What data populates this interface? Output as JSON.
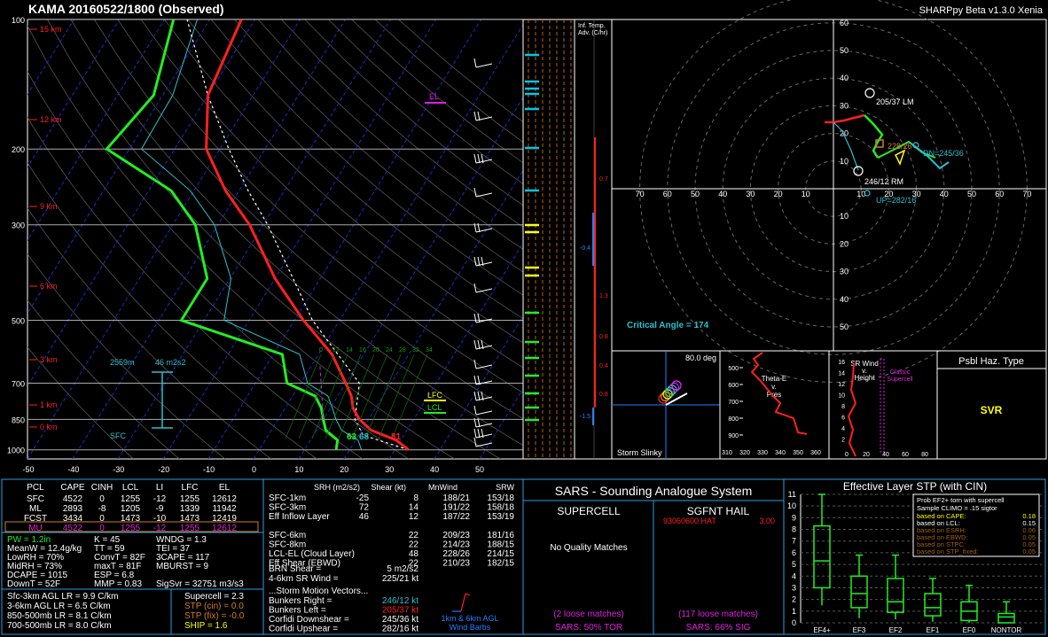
{
  "header": {
    "title": "KAMA   20160522/1800  (Observed)",
    "version": "SHARPpy Beta v1.3.0 Xenia"
  },
  "skewt": {
    "pressure_ticks": [
      "100",
      "200",
      "300",
      "500",
      "700",
      "850",
      "1000"
    ],
    "height_labels": [
      "15 km",
      "12 km",
      "9 km",
      "6 km",
      "3 km",
      "1 km",
      "0 km"
    ],
    "temp_ticks": [
      "-50",
      "-40",
      "-30",
      "-20",
      "-10",
      "0",
      "10",
      "20",
      "30",
      "40",
      "50"
    ],
    "el_label": "EL",
    "lfc_label": "LFC",
    "lcl_label": "LCL",
    "sfc_label": "SFC",
    "effective_top": "2559m",
    "effective_srh": "46 m2s2",
    "dewpoint_f": "63",
    "wetbulb_f": "68",
    "temp_f": "81",
    "wetbulb_ticks": [
      "0",
      "12",
      "14",
      "16",
      "20",
      "24",
      "28",
      "32",
      "34"
    ],
    "temperature_profile": [
      [
        1000,
        33
      ],
      [
        950,
        29
      ],
      [
        900,
        22
      ],
      [
        850,
        18
      ],
      [
        800,
        15
      ],
      [
        750,
        13
      ],
      [
        700,
        10
      ],
      [
        600,
        3
      ],
      [
        500,
        -8
      ],
      [
        400,
        -20
      ],
      [
        300,
        -33
      ],
      [
        250,
        -43
      ],
      [
        200,
        -53
      ],
      [
        150,
        -60
      ],
      [
        100,
        -63
      ]
    ],
    "dewpoint_profile": [
      [
        1000,
        17
      ],
      [
        950,
        16
      ],
      [
        900,
        12
      ],
      [
        850,
        10
      ],
      [
        800,
        8
      ],
      [
        750,
        5
      ],
      [
        700,
        -3
      ],
      [
        600,
        -8
      ],
      [
        500,
        -35
      ],
      [
        400,
        -35
      ],
      [
        300,
        -45
      ],
      [
        250,
        -55
      ],
      [
        200,
        -75
      ],
      [
        150,
        -72
      ],
      [
        100,
        -78
      ]
    ],
    "parcel_profile": [
      [
        1000,
        33
      ],
      [
        925,
        21
      ],
      [
        850,
        17
      ],
      [
        700,
        13
      ],
      [
        500,
        -6
      ],
      [
        400,
        -16
      ],
      [
        300,
        -29
      ],
      [
        250,
        -38
      ],
      [
        200,
        -48
      ],
      [
        150,
        -60
      ],
      [
        100,
        -75
      ]
    ],
    "colors": {
      "temperature": "#ff2020",
      "dewpoint": "#22ee22",
      "parcel": "#ffffff",
      "wetbulb": "#30c0d0",
      "isotherm": "#2040ff",
      "dry_adiabat": "#777777",
      "height": "#ff2020"
    }
  },
  "inferred_temp": {
    "title": "Inf. Temp. Adv. (C/hr)",
    "values": [
      "0.7",
      "-0.4",
      "1.3",
      "0.8",
      "0.4",
      "0.8",
      "-1.5"
    ]
  },
  "hodograph": {
    "ring_labels": [
      "10",
      "20",
      "30",
      "40",
      "50",
      "60",
      "70"
    ],
    "lm_label": "205/37 LM",
    "rm_label": "246/12 RM",
    "mean_label": "228/26",
    "dn_label": "DN=245/36",
    "up_label": "UP=282/16",
    "critical_angle": "Critical Angle = 174"
  },
  "storm_slinky": {
    "angle": "80.0 deg",
    "label": "Storm Slinky"
  },
  "theta_e": {
    "title": "Theta-E v. Pres",
    "pressure_ticks": [
      "500",
      "600",
      "700",
      "800",
      "900"
    ],
    "x_ticks": [
      "310",
      "320",
      "330",
      "340",
      "350",
      "360"
    ]
  },
  "srwind": {
    "title": "SR Wind v. Height",
    "classic": "Classic Supercell",
    "height_ticks": [
      "2",
      "4",
      "6",
      "8",
      "10",
      "12",
      "14",
      "16"
    ],
    "x_ticks": [
      "0",
      "20",
      "40",
      "60",
      "80"
    ]
  },
  "hazard": {
    "title": "Psbl Haz. Type",
    "value": "SVR"
  },
  "parcels": {
    "headers": [
      "PCL",
      "CAPE",
      "CINH",
      "LCL",
      "LI",
      "LFC",
      "EL"
    ],
    "rows": [
      [
        "SFC",
        "4522",
        "0",
        "1255",
        "-12",
        "1255",
        "12612"
      ],
      [
        "ML",
        "2893",
        "-8",
        "1205",
        "-9",
        "1339",
        "11942"
      ],
      [
        "FCST",
        "3434",
        "0",
        "1473",
        "-10",
        "1473",
        "12419"
      ],
      [
        "MU",
        "4522",
        "0",
        "1255",
        "-12",
        "1255",
        "12612"
      ]
    ]
  },
  "indices": {
    "col1": [
      "PW = 1.2in",
      "MeanW = 12.4g/kg",
      "LowRH = 70%",
      "MidRH = 73%",
      "DCAPE = 1015",
      "DownT = 52F"
    ],
    "col2": [
      "K = 45",
      "TT = 59",
      "ConvT = 82F",
      "maxT = 81F",
      "ESP = 6.8",
      "MMP = 0.83"
    ],
    "col3": [
      "WNDG = 1.3",
      "TEI = 37",
      "3CAPE = 117",
      "MBURST = 9",
      "",
      ""
    ],
    "sigsvr": "SigSvr = 32751 m3/s3",
    "lapse": [
      "Sfc-3km AGL LR = 9.9 C/km",
      "3-6km AGL LR = 6.5 C/km",
      "850-500mb LR = 8.1 C/km",
      "700-500mb LR = 8.0 C/km"
    ],
    "composite": [
      "Supercell = 2.3",
      "STP (cin) = 0.0",
      "STP (fix) = -0.0",
      "SHIP = 1.6"
    ]
  },
  "kinematics": {
    "headers": [
      "SRH (m2/s2)",
      "Shear (kt)",
      "MnWind",
      "SRW"
    ],
    "rows": [
      [
        "SFC-1km",
        "-25",
        "8",
        "188/21",
        "153/18"
      ],
      [
        "SFC-3km",
        "72",
        "14",
        "191/22",
        "158/18"
      ],
      [
        "Eff Inflow Layer",
        "46",
        "12",
        "187/22",
        "153/19"
      ],
      [
        "",
        "",
        "",
        "",
        ""
      ],
      [
        "SFC-6km",
        "",
        "22",
        "209/23",
        "181/16"
      ],
      [
        "SFC-8km",
        "",
        "22",
        "214/23",
        "188/15"
      ],
      [
        "LCL-EL (Cloud Layer)",
        "",
        "48",
        "228/26",
        "214/15"
      ],
      [
        "Eff Shear (EBWD)",
        "",
        "22",
        "210/23",
        "182/15"
      ]
    ],
    "brn": [
      "BRN Shear =",
      "5 m2/s2"
    ],
    "sr46": [
      "4-6km SR Wind =",
      "225/21 kt"
    ],
    "motion_title": "...Storm Motion Vectors...",
    "motions": [
      [
        "Bunkers Right =",
        "246/12 kt"
      ],
      [
        "Bunkers Left =",
        "205/37 kt"
      ],
      [
        "Corfidi Downshear =",
        "245/36 kt"
      ],
      [
        "Corfidi Upshear =",
        "282/16 kt"
      ]
    ],
    "barb_label": [
      "1km & 6km AGL",
      "Wind Barbs"
    ]
  },
  "sars": {
    "title": "SARS - Sounding Analogue System",
    "supercell_title": "SUPERCELL",
    "hail_title": "SGFNT HAIL",
    "supercell_match": "No Quality Matches",
    "hail_match_id": "93060600.HAT",
    "hail_match_val": "3.00",
    "supercell_loose": "(2 loose matches)",
    "hail_loose": "(117 loose matches)",
    "supercell_pct": "SARS: 50% TOR",
    "hail_pct": "SARS: 66% SIG"
  },
  "stp": {
    "title": "Effective Layer STP (with CIN)",
    "y_ticks": [
      "0",
      "1",
      "2",
      "3",
      "4",
      "5",
      "6",
      "7",
      "8",
      "9",
      "10",
      "11"
    ],
    "categories": [
      "EF4+",
      "EF3",
      "EF2",
      "EF1",
      "EF0",
      "NONTOR"
    ],
    "legend_title": [
      "Prob EF2+ torn with supercell",
      "Sample CLIMO = .15 sigtor"
    ],
    "legend_rows": [
      [
        "based on CAPE:",
        "0.18"
      ],
      [
        "based on LCL:",
        "0.15"
      ],
      [
        "based on ESRH:",
        "0.06"
      ],
      [
        "based on EBWD:",
        "0.05"
      ],
      [
        "based on STPC:",
        "0.05"
      ],
      [
        "based on STP_fixed:",
        "0.05"
      ]
    ]
  },
  "chart_data": {
    "type": "bar",
    "title": "Effective Layer STP (with CIN)",
    "categories": [
      "EF4+",
      "EF3",
      "EF2",
      "EF1",
      "EF0",
      "NONTOR"
    ],
    "whisker_low": [
      1.5,
      0.4,
      0.3,
      0.1,
      0.0,
      0.0
    ],
    "box_low": [
      3.0,
      1.3,
      0.9,
      0.6,
      0.2,
      0.0
    ],
    "median": [
      5.3,
      2.5,
      1.8,
      1.3,
      1.0,
      0.5
    ],
    "box_high": [
      8.3,
      4.0,
      3.8,
      2.5,
      1.8,
      0.8
    ],
    "whisker_high": [
      11.0,
      5.8,
      5.8,
      3.8,
      3.2,
      1.8
    ],
    "ylim": [
      0,
      11
    ]
  }
}
